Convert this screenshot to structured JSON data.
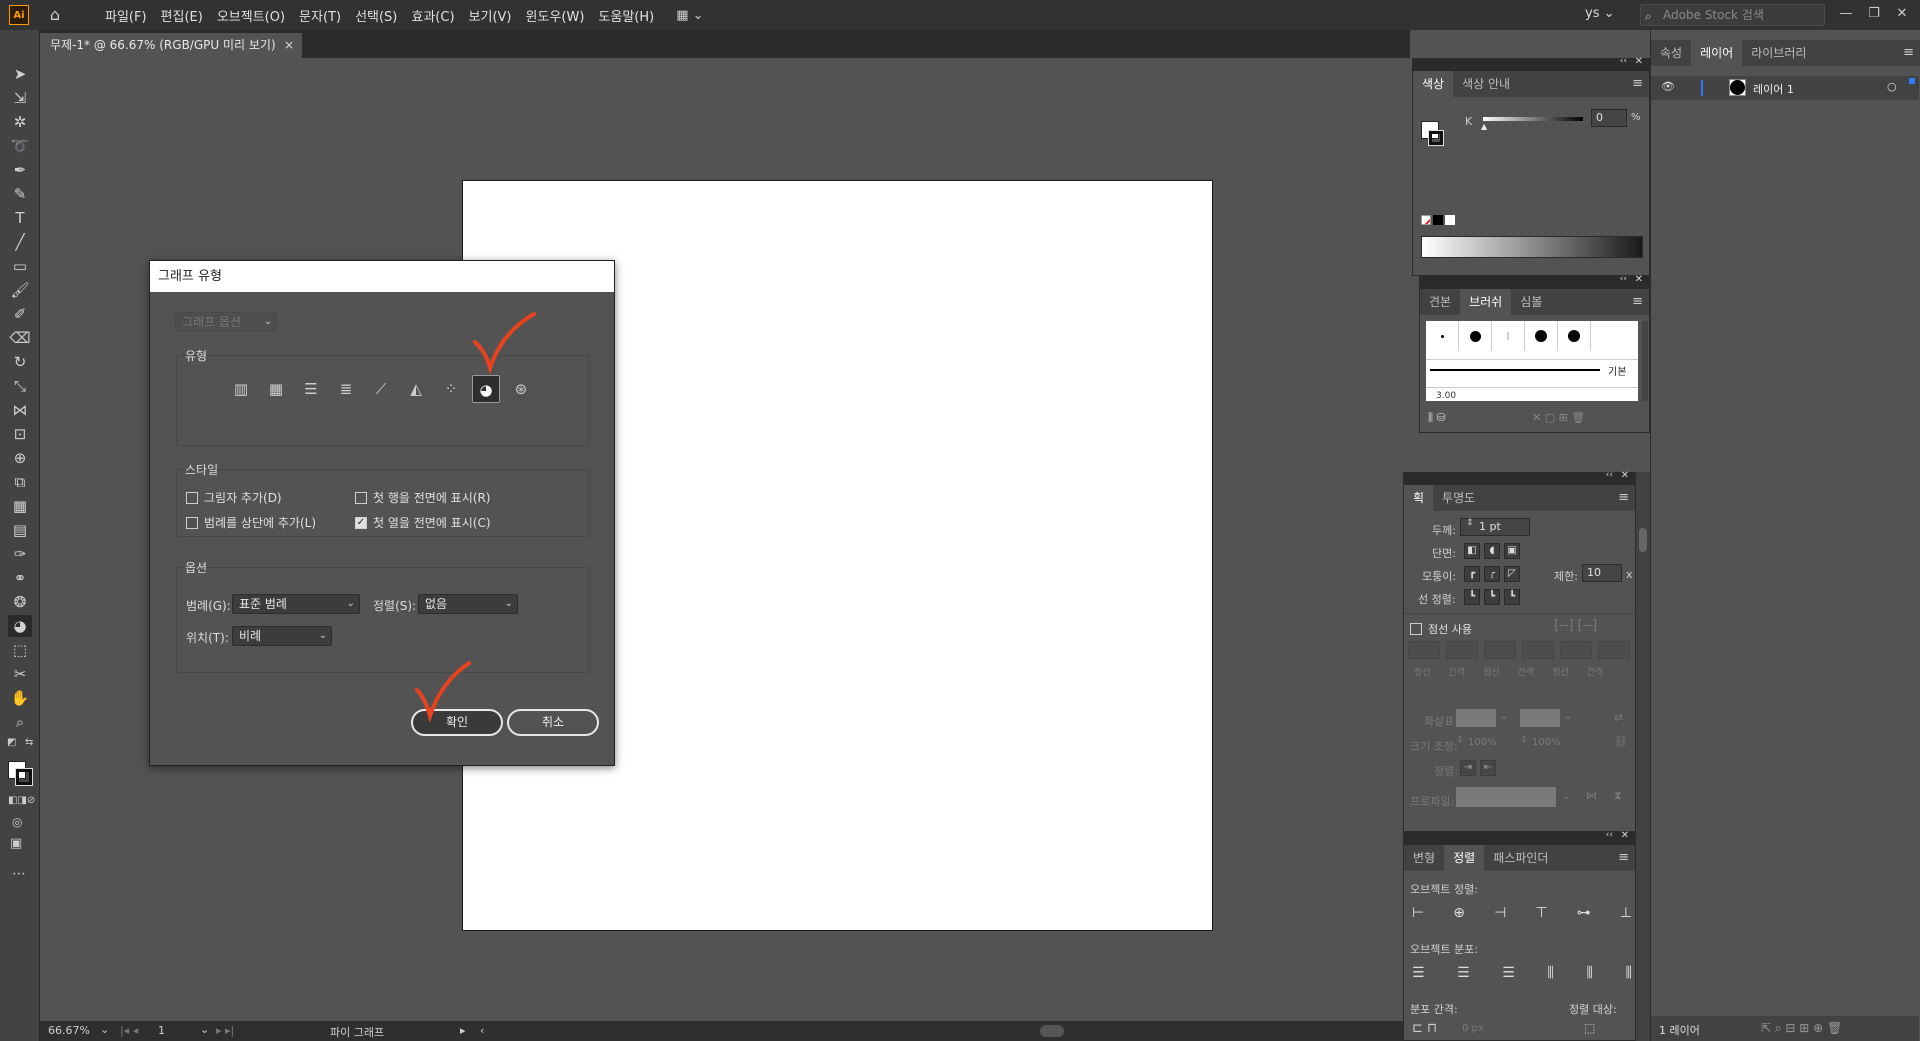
{
  "app": {
    "logo": "Ai",
    "icons": {
      "home": "home-icon"
    }
  },
  "menu": [
    "파일(F)",
    "편집(E)",
    "오브젝트(O)",
    "문자(T)",
    "선택(S)",
    "효과(C)",
    "보기(V)",
    "윈도우(W)",
    "도움말(H)"
  ],
  "topbar": {
    "user": "ys",
    "search_placeholder": "Adobe Stock 검색"
  },
  "document_tab": {
    "title": "무제-1* @ 66.67% (RGB/GPU 미리 보기)",
    "close": "×"
  },
  "status": {
    "zoom": "66.67%",
    "artboard": "1",
    "tool_label": "파이 그래프"
  },
  "dialog": {
    "title": "그래프 유형",
    "graph_options_dropdown": "그래프 옵션",
    "type_group_label": "유형",
    "graph_types": [
      "column",
      "stacked-column",
      "bar",
      "stacked-bar",
      "line",
      "area",
      "scatter",
      "pie",
      "radar"
    ],
    "selected_type": "pie",
    "style_label": "스타일",
    "style_options": [
      {
        "label": "그림자 추가(D)",
        "checked": false
      },
      {
        "label": "첫 행을 전면에 표시(R)",
        "checked": false
      },
      {
        "label": "범례를 상단에 추가(L)",
        "checked": false
      },
      {
        "label": "첫 열을 전면에 표시(C)",
        "checked": true
      }
    ],
    "options_label": "옵션",
    "legend_label": "범례(G):",
    "legend_value": "표준 범례",
    "sort_label": "정렬(S):",
    "sort_value": "없음",
    "position_label": "위치(T):",
    "position_value": "비례",
    "ok": "확인",
    "cancel": "취소"
  },
  "color_panel": {
    "tabs": [
      "색상",
      "색상 안내"
    ],
    "channel": "K",
    "value": "0",
    "unit": "%"
  },
  "brush_panel": {
    "tabs": [
      "견본",
      "브러쉬",
      "심볼"
    ],
    "basic_label": "기본",
    "size_label": "3.00"
  },
  "stroke_panel": {
    "tabs": [
      "획",
      "투명도"
    ],
    "weight_label": "두께:",
    "weight_value": "1 pt",
    "cap_label": "단면:",
    "corner_label": "모퉁이:",
    "limit_label": "제한:",
    "limit_value": "10",
    "limit_unit": "x",
    "align_label": "선 정렬:",
    "dashed_label": "점선 사용",
    "dash_cols": [
      "점선",
      "간격",
      "점선",
      "간격",
      "점선",
      "간격"
    ],
    "arrow_label": "화살표:",
    "scale_label": "크기 조정:",
    "scale_value1": "100%",
    "scale_value2": "100%",
    "arrow_align_label": "정렬:",
    "profile_label": "프로파일:"
  },
  "align_panel": {
    "tabs": [
      "변형",
      "정렬",
      "패스파인더"
    ],
    "object_align_label": "오브젝트 정렬:",
    "object_distribute_label": "오브젝트 분포:",
    "distribute_spacing_label": "분포 간격:",
    "align_to_label": "정렬 대상:",
    "spacing_value": "0 px"
  },
  "layers_panel": {
    "tabs": [
      "속성",
      "레이어",
      "라이브러리"
    ],
    "layer_name": "레이어 1",
    "footer": "1 레이어"
  }
}
